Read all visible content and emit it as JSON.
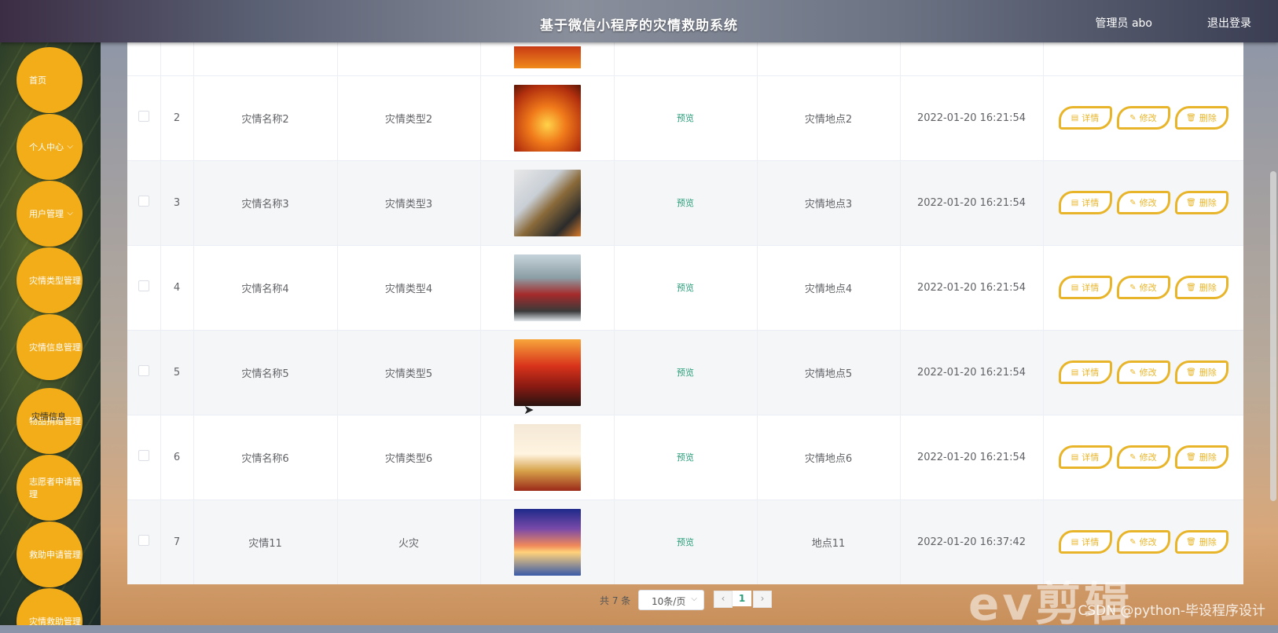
{
  "header": {
    "title": "基于微信小程序的灾情救助系统",
    "user": "管理员 abo",
    "logout": "退出登录"
  },
  "sidebar": {
    "items": [
      {
        "label": "首页",
        "has_children": false
      },
      {
        "label": "个人中心",
        "has_children": true
      },
      {
        "label": "用户管理",
        "has_children": true
      },
      {
        "label": "灾情类型管理",
        "has_children": false
      },
      {
        "label": "灾情信息管理",
        "has_children": false
      },
      {
        "label": "物品捐赠管理",
        "has_children": false
      },
      {
        "label": "志愿者申请管理",
        "has_children": false
      },
      {
        "label": "救助申请管理",
        "has_children": false
      },
      {
        "label": "灾情救助管理",
        "has_children": false
      }
    ],
    "submenu_active": "灾情信息"
  },
  "table": {
    "rows": [
      {
        "index": "2",
        "name": "灾情名称2",
        "type": "灾情类型2",
        "image": "fire-rescue-photo",
        "preview": "预览",
        "location": "灾情地点2",
        "time": "2022-01-20 16:21:54"
      },
      {
        "index": "3",
        "name": "灾情名称3",
        "type": "灾情类型3",
        "image": "firefighter-photo",
        "preview": "预览",
        "location": "灾情地点3",
        "time": "2022-01-20 16:21:54"
      },
      {
        "index": "4",
        "name": "灾情名称4",
        "type": "灾情类型4",
        "image": "fire-truck-photo",
        "preview": "预览",
        "location": "灾情地点4",
        "time": "2022-01-20 16:21:54"
      },
      {
        "index": "5",
        "name": "灾情名称5",
        "type": "灾情类型5",
        "image": "fire-engine-flames-photo",
        "preview": "预览",
        "location": "灾情地点5",
        "time": "2022-01-20 16:21:54"
      },
      {
        "index": "6",
        "name": "灾情名称6",
        "type": "灾情类型6",
        "image": "fire-safety-poster",
        "preview": "预览",
        "location": "灾情地点6",
        "time": "2022-01-20 16:21:54"
      },
      {
        "index": "7",
        "name": "灾情11",
        "type": "火灾",
        "image": "sunset-dolphin-photo",
        "preview": "预览",
        "location": "地点11",
        "time": "2022-01-20 16:37:42"
      }
    ],
    "actions": {
      "detail": "详情",
      "edit": "修改",
      "delete": "删除"
    }
  },
  "pagination": {
    "total": "共 7 条",
    "page_size": "10条/页",
    "current": "1"
  },
  "watermark": "CSDN @python-毕设程序设计",
  "overlay_logo": "ev剪辑",
  "colors": {
    "accent": "#f3ad19",
    "button_border": "#e8b52a",
    "preview_link": "#2a9d7a"
  }
}
